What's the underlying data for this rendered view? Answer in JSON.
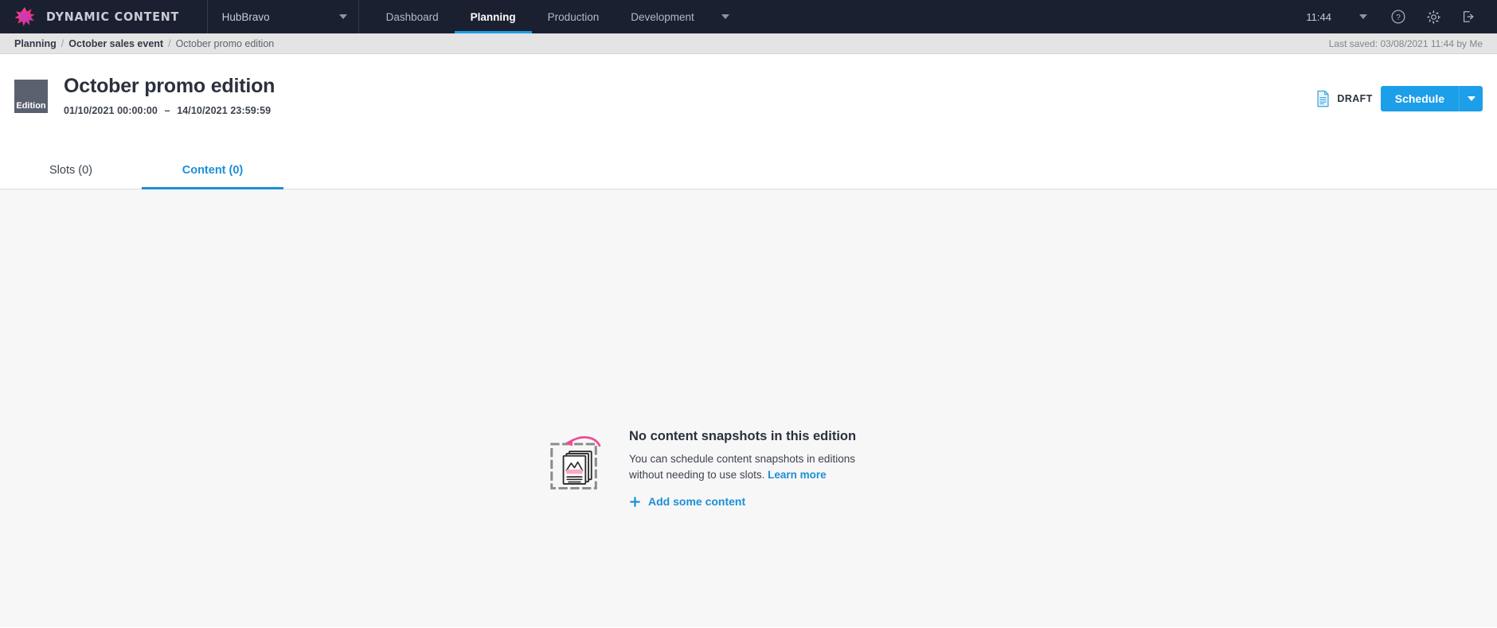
{
  "topbar": {
    "brand_name": "DYNAMIC CONTENT",
    "logo_icon": "dynamic-content-starburst-logo",
    "hub_name": "HubBravo",
    "hub_caret_icon": "chevron-down-icon",
    "nav_items": [
      {
        "label": "Dashboard",
        "active": false
      },
      {
        "label": "Planning",
        "active": true
      },
      {
        "label": "Production",
        "active": false
      },
      {
        "label": "Development",
        "active": false
      }
    ],
    "nav_more_icon": "chevron-down-icon",
    "clock": "11:44",
    "clock_caret_icon": "chevron-down-icon",
    "help_icon": "help-circle-icon",
    "settings_icon": "gear-icon",
    "logout_icon": "sign-out-icon",
    "bg_color": "#1b2030",
    "active_underline_color": "#1d9ee9"
  },
  "breadcrumb": {
    "items": [
      {
        "label": "Planning"
      },
      {
        "label": "October sales event"
      },
      {
        "label": "October promo edition"
      }
    ],
    "separator": "/",
    "last_saved": "Last saved: 03/08/2021 11:44 by Me"
  },
  "page_header": {
    "badge_label": "Edition",
    "title": "October promo edition",
    "date_start": "01/10/2021 00:00:00",
    "date_separator": "–",
    "date_end": "14/10/2021 23:59:59",
    "status_icon": "draft-document-icon",
    "status_label": "DRAFT",
    "primary_button": "Schedule",
    "primary_button_caret_icon": "chevron-down-icon",
    "primary_color": "#1d9ee9",
    "badge_color": "#5a616e"
  },
  "tabs": [
    {
      "label": "Slots (0)",
      "active": false
    },
    {
      "label": "Content (0)",
      "active": true
    }
  ],
  "empty_state": {
    "illustration_icon": "content-snapshots-dropzone-illustration",
    "title": "No content snapshots in this edition",
    "description": "You can schedule content snapshots in editions without needing to use slots.",
    "learn_more": "Learn more",
    "add_icon": "plus-icon",
    "add_label": "Add some content",
    "link_color": "#1d8fd6"
  }
}
